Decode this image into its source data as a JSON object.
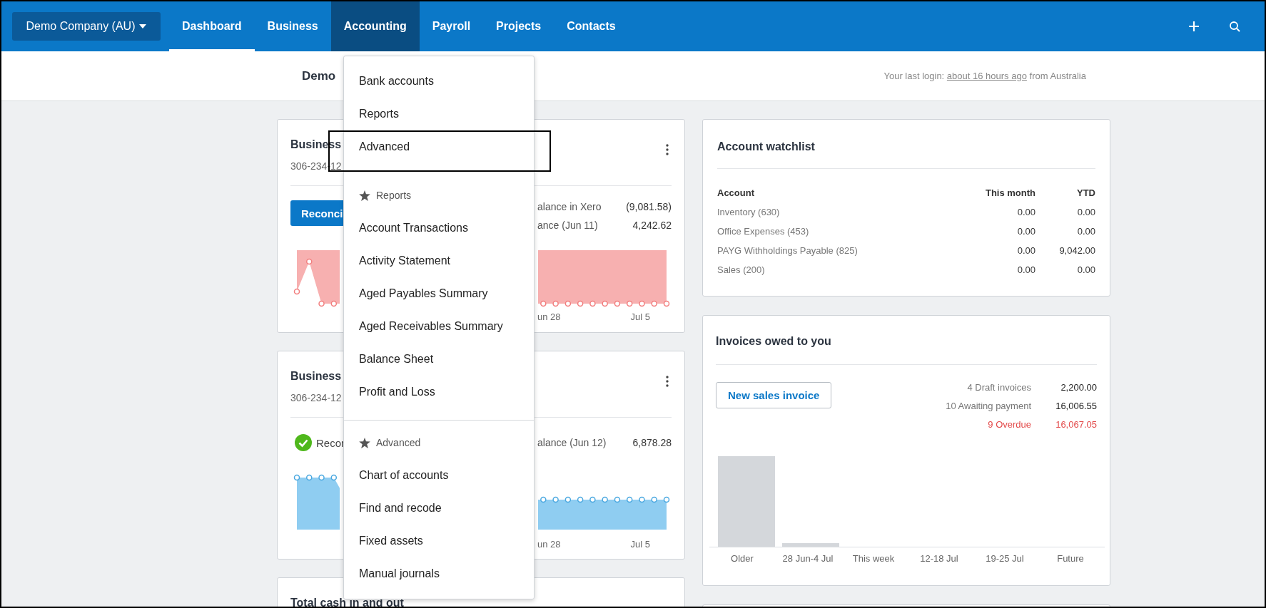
{
  "top_nav": {
    "organisation": "Demo Company (AU)",
    "items": [
      {
        "label": "Dashboard",
        "selected": true,
        "expanded": false
      },
      {
        "label": "Business",
        "selected": false,
        "expanded": false
      },
      {
        "label": "Accounting",
        "selected": false,
        "expanded": true
      },
      {
        "label": "Payroll",
        "selected": false,
        "expanded": false
      },
      {
        "label": "Projects",
        "selected": false,
        "expanded": false
      },
      {
        "label": "Contacts",
        "selected": false,
        "expanded": false
      }
    ]
  },
  "header": {
    "title": "Demo",
    "last_login": {
      "prefix": "Your last login: ",
      "link": "about 16 hours ago",
      "suffix": " from Australia"
    }
  },
  "bank_cards": [
    {
      "title": "Business",
      "account_number": "306-234-12",
      "status": {
        "kind": "button",
        "label": "Reconci"
      },
      "balances": [
        {
          "label": "alance in Xero",
          "value": "(9,081.58)"
        },
        {
          "label": "ance (Jun 11)",
          "value": "4,242.62"
        }
      ],
      "overdrawn": true,
      "x_labels": [
        "un 28",
        "Jul 5"
      ]
    },
    {
      "title": "Business",
      "account_number": "306-234-12",
      "status": {
        "kind": "reconciled",
        "label": "Recor"
      },
      "balances": [
        {
          "label": "alance (Jun 12)",
          "value": "6,878.28"
        }
      ],
      "overdrawn": false,
      "x_labels": [
        "un 28",
        "Jul 5"
      ]
    }
  ],
  "cash_card": {
    "title": "Total cash in and out"
  },
  "accounting_menu": {
    "items": [
      {
        "kind": "link",
        "label": "Bank accounts",
        "outlined": false
      },
      {
        "kind": "link",
        "label": "Reports",
        "outlined": false
      },
      {
        "kind": "link",
        "label": "Advanced",
        "outlined": true
      },
      {
        "kind": "heading",
        "label": "Reports"
      },
      {
        "kind": "link",
        "label": "Account Transactions",
        "outlined": false
      },
      {
        "kind": "link",
        "label": "Activity Statement",
        "outlined": false
      },
      {
        "kind": "link",
        "label": "Aged Payables Summary",
        "outlined": false
      },
      {
        "kind": "link",
        "label": "Aged Receivables Summary",
        "outlined": false
      },
      {
        "kind": "link",
        "label": "Balance Sheet",
        "outlined": false
      },
      {
        "kind": "link",
        "label": "Profit and Loss",
        "outlined": false
      },
      {
        "kind": "divider"
      },
      {
        "kind": "heading",
        "label": "Advanced"
      },
      {
        "kind": "link",
        "label": "Chart of accounts",
        "outlined": false
      },
      {
        "kind": "link",
        "label": "Find and recode",
        "outlined": false
      },
      {
        "kind": "link",
        "label": "Fixed assets",
        "outlined": false
      },
      {
        "kind": "link",
        "label": "Manual journals",
        "outlined": false
      }
    ]
  },
  "watchlist": {
    "title": "Account watchlist",
    "columns": [
      "Account",
      "This month",
      "YTD"
    ],
    "rows": [
      [
        "Inventory (630)",
        "0.00",
        "0.00"
      ],
      [
        "Office Expenses (453)",
        "0.00",
        "0.00"
      ],
      [
        "PAYG Withholdings Payable (825)",
        "0.00",
        "9,042.00"
      ],
      [
        "Sales (200)",
        "0.00",
        "0.00"
      ]
    ]
  },
  "invoices": {
    "title": "Invoices owed to you",
    "button": "New sales invoice",
    "summary": [
      {
        "label": "4 Draft invoices",
        "value": "2,200.00",
        "overdue": false
      },
      {
        "label": "10 Awaiting payment",
        "value": "16,006.55",
        "overdue": false
      },
      {
        "label": "9 Overdue",
        "value": "16,067.05",
        "overdue": true
      }
    ],
    "categories": [
      "Older",
      "28 Jun-4 Jul",
      "This week",
      "12-18 Jul",
      "19-25 Jul",
      "Future"
    ]
  }
}
